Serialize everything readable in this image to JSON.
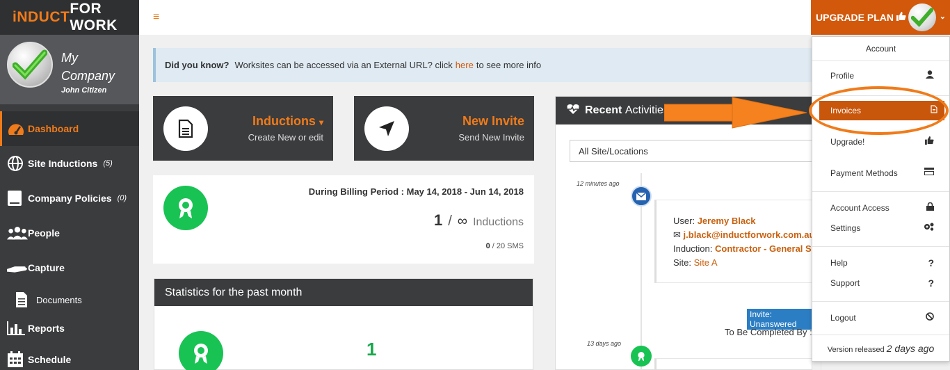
{
  "brand": {
    "logo_part1": "iNDUCT",
    "logo_part2": "FOR WORK"
  },
  "profile": {
    "company_line1": "My",
    "company_line2": "Company",
    "user": "John Citizen"
  },
  "nav": [
    {
      "label": "Dashboard",
      "count": ""
    },
    {
      "label": "Site Inductions",
      "count": "(5)"
    },
    {
      "label": "Company Policies",
      "count": "(0)"
    },
    {
      "label": "People",
      "count": ""
    },
    {
      "label": "Capture",
      "count": ""
    },
    {
      "label": "Documents",
      "count": ""
    },
    {
      "label": "Reports",
      "count": ""
    },
    {
      "label": "Schedule",
      "count": ""
    }
  ],
  "topbar": {
    "menu_glyph": "≡",
    "upgrade_label": "UPGRADE PLAN",
    "chevron": "⌄"
  },
  "tip": {
    "lead": "Did you know?",
    "text": "Worksites can be accessed via an External URL? click",
    "link": "here",
    "tail": "to see more info"
  },
  "cards": {
    "inductions": {
      "title": "Inductions",
      "caret": "▾",
      "subtitle": "Create New or edit"
    },
    "invite": {
      "title": "New Invite",
      "subtitle": "Send New Invite"
    }
  },
  "billing": {
    "period": "During Billing Period : May 14, 2018 - Jun 14, 2018",
    "count": "1",
    "slash": "/",
    "limit": "∞",
    "unit": "Inductions",
    "sms_count": "0",
    "sms_total": "/ 20 SMS"
  },
  "stats": {
    "title": "Statistics for the past month",
    "value": "1"
  },
  "recent": {
    "title_bold": "Recent",
    "title_rest": "Activities",
    "filter_value": "All Site/Locations",
    "time1": "12 minutes ago",
    "time2": "13 days ago",
    "user_label": "User:",
    "user_name": "Jeremy Black",
    "email": "j.black@inductforwork.com.au",
    "induction_label": "Induction:",
    "induction_name": "Contractor - General Site",
    "site_label": "Site:",
    "site_name": "Site A",
    "badge": "Invite: Unanswered",
    "completed_by": "To Be Completed By :"
  },
  "dropdown": {
    "header": "Account",
    "items": {
      "profile": "Profile",
      "invoices": "Invoices",
      "upgrade": "Upgrade!",
      "payment": "Payment Methods",
      "access": "Account Access",
      "settings": "Settings",
      "help": "Help",
      "support": "Support",
      "logout": "Logout"
    },
    "version_prefix": "Version released",
    "version_age": "2 days ago"
  },
  "colors": {
    "accent": "#f07b1a",
    "sidebar": "#3b3c3e",
    "green": "#18c353",
    "selected": "#c8560b",
    "badge": "#2c7ec4"
  }
}
